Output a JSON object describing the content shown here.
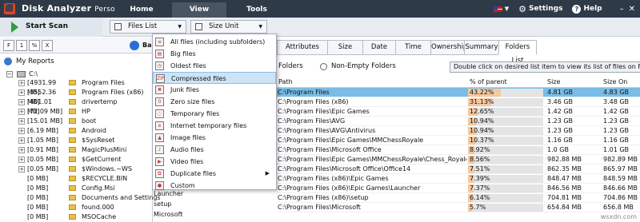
{
  "app": {
    "title": "Disk Analyzer",
    "edition": "Personal",
    "menu": [
      "Home",
      "View",
      "Tools"
    ],
    "active_menu": "View",
    "settings_label": "Settings",
    "help_label": "Help",
    "window_controls": [
      "–",
      "✕"
    ]
  },
  "toolbar": {
    "start_scan": "Start Scan",
    "files_list": "Files List",
    "size_unit": "Size Unit"
  },
  "left": {
    "mini_buttons": [
      "F",
      "1",
      "%",
      "X"
    ],
    "back_label": "Ba",
    "my_reports": "My Reports",
    "root": "C:\\",
    "tree": [
      {
        "size": "[4931.99 MB]",
        "name": "Program Files",
        "expand": true
      },
      {
        "size": "[3552.36 MB]",
        "name": "Program Files (x86)",
        "expand": true
      },
      {
        "size": "[401.01 MB]",
        "name": "drivertemp",
        "expand": true
      },
      {
        "size": "[72.09 MB]",
        "name": "HP",
        "expand": true
      },
      {
        "size": "[15.01 MB]",
        "name": "boot",
        "expand": true
      },
      {
        "size": "[6.19 MB]",
        "name": "Android",
        "expand": true
      },
      {
        "size": "[1.05 MB]",
        "name": "$SysReset",
        "expand": true
      },
      {
        "size": "[0.91 MB]",
        "name": "MagicPlusMini",
        "expand": true
      },
      {
        "size": "[0.05 MB]",
        "name": "$GetCurrent",
        "expand": true
      },
      {
        "size": "[0.05 MB]",
        "name": "$Windows.~WS",
        "expand": true
      },
      {
        "size": "[0 MB]",
        "name": "$RECYCLE.BIN",
        "expand": false
      },
      {
        "size": "[0 MB]",
        "name": "Config.Msi",
        "expand": false
      },
      {
        "size": "[0 MB]",
        "name": "Documents and Settings",
        "expand": false
      },
      {
        "size": "[0 MB]",
        "name": "found.000",
        "expand": false
      },
      {
        "size": "[0 MB]",
        "name": "MSOCache",
        "expand": false
      }
    ]
  },
  "dropdown": {
    "items": [
      {
        "label": "All files (including subfolders)",
        "icon": "list-icon"
      },
      {
        "label": "Big files",
        "icon": "big-file-icon"
      },
      {
        "label": "Oldest files",
        "icon": "clock-icon"
      },
      {
        "label": "Compressed files",
        "icon": "zip-icon",
        "highlight": true
      },
      {
        "label": "Junk files",
        "icon": "trash-icon"
      },
      {
        "label": "Zero size files",
        "icon": "zero-file-icon"
      },
      {
        "label": "Temporary files",
        "icon": "temp-file-icon"
      },
      {
        "label": "Internet temporary files",
        "icon": "globe-icon"
      },
      {
        "label": "Image files",
        "icon": "image-icon"
      },
      {
        "label": "Audio files",
        "icon": "audio-icon"
      },
      {
        "label": "Video files",
        "icon": "video-icon"
      },
      {
        "label": "Duplicate files",
        "icon": "duplicate-icon",
        "submenu": true
      },
      {
        "label": "Custom",
        "icon": "custom-icon"
      }
    ],
    "icon_glyphs": [
      "≡",
      "▤",
      "◷",
      "ZIP",
      "✖",
      "0",
      "◌",
      "e",
      "▲",
      "♪",
      "▶",
      "⧉",
      "●"
    ]
  },
  "right": {
    "tabs": [
      "Attributes",
      "Size",
      "Date",
      "Time",
      "Ownership",
      "Summary",
      "Folders List"
    ],
    "active_tab": "Folders List",
    "options": [
      "Folders",
      "Non-Empty Folders"
    ],
    "hint": "Double click on desired list item to view its list of files on File Viewer",
    "columns": [
      "Path",
      "% of parent",
      "Size",
      "Size On Disk"
    ],
    "rows": [
      {
        "path": "C:\\Program Files",
        "pct": "43.22%",
        "pct_value": 43.22,
        "size": "4.81 GB",
        "sod": "4.83 GB",
        "selected": true
      },
      {
        "path": "C:\\Program Files (x86)",
        "pct": "31.13%",
        "pct_value": 31.13,
        "size": "3.46 GB",
        "sod": "3.48 GB"
      },
      {
        "path": "C:\\Program Files\\Epic Games",
        "pct": "12.65%",
        "pct_value": 12.65,
        "size": "1.42 GB",
        "sod": "1.42 GB"
      },
      {
        "path": "C:\\Program Files\\AVG",
        "pct": "10.94%",
        "pct_value": 10.94,
        "size": "1.23 GB",
        "sod": "1.23 GB"
      },
      {
        "path": "C:\\Program Files\\AVG\\Antivirus",
        "pct": "10.94%",
        "pct_value": 10.94,
        "size": "1.23 GB",
        "sod": "1.23 GB"
      },
      {
        "path": "C:\\Program Files\\Epic Games\\MMChessRoyale",
        "pct": "10.37%",
        "pct_value": 10.37,
        "size": "1.16 GB",
        "sod": "1.16 GB"
      },
      {
        "path": "C:\\Program Files\\Microsoft Office",
        "pct": "8.92%",
        "pct_value": 8.92,
        "size": "1.0 GB",
        "sod": "1.01 GB"
      },
      {
        "path": "C:\\Program Files\\Epic Games\\MMChessRoyale\\Chess_Royale_...",
        "pct": "8.56%",
        "pct_value": 8.56,
        "size": "982.88 MB",
        "sod": "982.89 MB"
      },
      {
        "path": "C:\\Program Files\\Microsoft Office\\Office14",
        "pct": "7.51%",
        "pct_value": 7.51,
        "size": "862.35 MB",
        "sod": "865.97 MB"
      },
      {
        "path": "C:\\Program Files (x86)\\Epic Games",
        "pct": "7.39%",
        "pct_value": 7.39,
        "size": "848.47 MB",
        "sod": "848.59 MB"
      },
      {
        "path": "C:\\Program Files (x86)\\Epic Games\\Launcher",
        "pct": "7.37%",
        "pct_value": 7.37,
        "size": "846.56 MB",
        "sod": "846.66 MB"
      },
      {
        "path": "C:\\Program Files (x86)\\setup",
        "pct": "6.14%",
        "pct_value": 6.14,
        "size": "704.81 MB",
        "sod": "704.86 MB"
      },
      {
        "path": "C:\\Program Files\\Microsoft",
        "pct": "5.7%",
        "pct_value": 5.7,
        "size": "654.84 MB",
        "sod": "656.8 MB"
      }
    ]
  },
  "left_list": [
    "Launcher",
    "setup",
    "Microsoft"
  ],
  "watermark": "wsxdn.com",
  "colors": {
    "titlebar": "#2e3a48",
    "selected_row": "#79bde6",
    "pct_fill": "#f5c8a0",
    "menu_highlight": "#cde4f7",
    "folder": "#e8c04a",
    "start_icon": "#2d9e3a"
  }
}
